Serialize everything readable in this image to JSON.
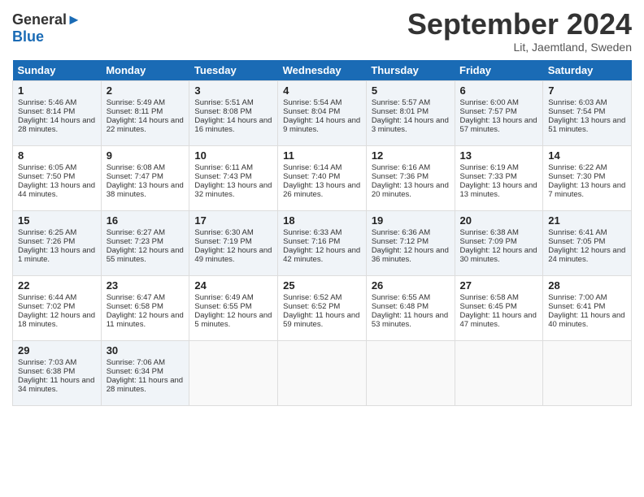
{
  "header": {
    "logo_line1": "General",
    "logo_line2": "Blue",
    "month": "September 2024",
    "location": "Lit, Jaemtland, Sweden"
  },
  "days_of_week": [
    "Sunday",
    "Monday",
    "Tuesday",
    "Wednesday",
    "Thursday",
    "Friday",
    "Saturday"
  ],
  "weeks": [
    [
      {
        "day": "1",
        "info": "Sunrise: 5:46 AM\nSunset: 8:14 PM\nDaylight: 14 hours and 28 minutes."
      },
      {
        "day": "2",
        "info": "Sunrise: 5:49 AM\nSunset: 8:11 PM\nDaylight: 14 hours and 22 minutes."
      },
      {
        "day": "3",
        "info": "Sunrise: 5:51 AM\nSunset: 8:08 PM\nDaylight: 14 hours and 16 minutes."
      },
      {
        "day": "4",
        "info": "Sunrise: 5:54 AM\nSunset: 8:04 PM\nDaylight: 14 hours and 9 minutes."
      },
      {
        "day": "5",
        "info": "Sunrise: 5:57 AM\nSunset: 8:01 PM\nDaylight: 14 hours and 3 minutes."
      },
      {
        "day": "6",
        "info": "Sunrise: 6:00 AM\nSunset: 7:57 PM\nDaylight: 13 hours and 57 minutes."
      },
      {
        "day": "7",
        "info": "Sunrise: 6:03 AM\nSunset: 7:54 PM\nDaylight: 13 hours and 51 minutes."
      }
    ],
    [
      {
        "day": "8",
        "info": "Sunrise: 6:05 AM\nSunset: 7:50 PM\nDaylight: 13 hours and 44 minutes."
      },
      {
        "day": "9",
        "info": "Sunrise: 6:08 AM\nSunset: 7:47 PM\nDaylight: 13 hours and 38 minutes."
      },
      {
        "day": "10",
        "info": "Sunrise: 6:11 AM\nSunset: 7:43 PM\nDaylight: 13 hours and 32 minutes."
      },
      {
        "day": "11",
        "info": "Sunrise: 6:14 AM\nSunset: 7:40 PM\nDaylight: 13 hours and 26 minutes."
      },
      {
        "day": "12",
        "info": "Sunrise: 6:16 AM\nSunset: 7:36 PM\nDaylight: 13 hours and 20 minutes."
      },
      {
        "day": "13",
        "info": "Sunrise: 6:19 AM\nSunset: 7:33 PM\nDaylight: 13 hours and 13 minutes."
      },
      {
        "day": "14",
        "info": "Sunrise: 6:22 AM\nSunset: 7:30 PM\nDaylight: 13 hours and 7 minutes."
      }
    ],
    [
      {
        "day": "15",
        "info": "Sunrise: 6:25 AM\nSunset: 7:26 PM\nDaylight: 13 hours and 1 minute."
      },
      {
        "day": "16",
        "info": "Sunrise: 6:27 AM\nSunset: 7:23 PM\nDaylight: 12 hours and 55 minutes."
      },
      {
        "day": "17",
        "info": "Sunrise: 6:30 AM\nSunset: 7:19 PM\nDaylight: 12 hours and 49 minutes."
      },
      {
        "day": "18",
        "info": "Sunrise: 6:33 AM\nSunset: 7:16 PM\nDaylight: 12 hours and 42 minutes."
      },
      {
        "day": "19",
        "info": "Sunrise: 6:36 AM\nSunset: 7:12 PM\nDaylight: 12 hours and 36 minutes."
      },
      {
        "day": "20",
        "info": "Sunrise: 6:38 AM\nSunset: 7:09 PM\nDaylight: 12 hours and 30 minutes."
      },
      {
        "day": "21",
        "info": "Sunrise: 6:41 AM\nSunset: 7:05 PM\nDaylight: 12 hours and 24 minutes."
      }
    ],
    [
      {
        "day": "22",
        "info": "Sunrise: 6:44 AM\nSunset: 7:02 PM\nDaylight: 12 hours and 18 minutes."
      },
      {
        "day": "23",
        "info": "Sunrise: 6:47 AM\nSunset: 6:58 PM\nDaylight: 12 hours and 11 minutes."
      },
      {
        "day": "24",
        "info": "Sunrise: 6:49 AM\nSunset: 6:55 PM\nDaylight: 12 hours and 5 minutes."
      },
      {
        "day": "25",
        "info": "Sunrise: 6:52 AM\nSunset: 6:52 PM\nDaylight: 11 hours and 59 minutes."
      },
      {
        "day": "26",
        "info": "Sunrise: 6:55 AM\nSunset: 6:48 PM\nDaylight: 11 hours and 53 minutes."
      },
      {
        "day": "27",
        "info": "Sunrise: 6:58 AM\nSunset: 6:45 PM\nDaylight: 11 hours and 47 minutes."
      },
      {
        "day": "28",
        "info": "Sunrise: 7:00 AM\nSunset: 6:41 PM\nDaylight: 11 hours and 40 minutes."
      }
    ],
    [
      {
        "day": "29",
        "info": "Sunrise: 7:03 AM\nSunset: 6:38 PM\nDaylight: 11 hours and 34 minutes."
      },
      {
        "day": "30",
        "info": "Sunrise: 7:06 AM\nSunset: 6:34 PM\nDaylight: 11 hours and 28 minutes."
      },
      {
        "day": "",
        "info": ""
      },
      {
        "day": "",
        "info": ""
      },
      {
        "day": "",
        "info": ""
      },
      {
        "day": "",
        "info": ""
      },
      {
        "day": "",
        "info": ""
      }
    ]
  ]
}
